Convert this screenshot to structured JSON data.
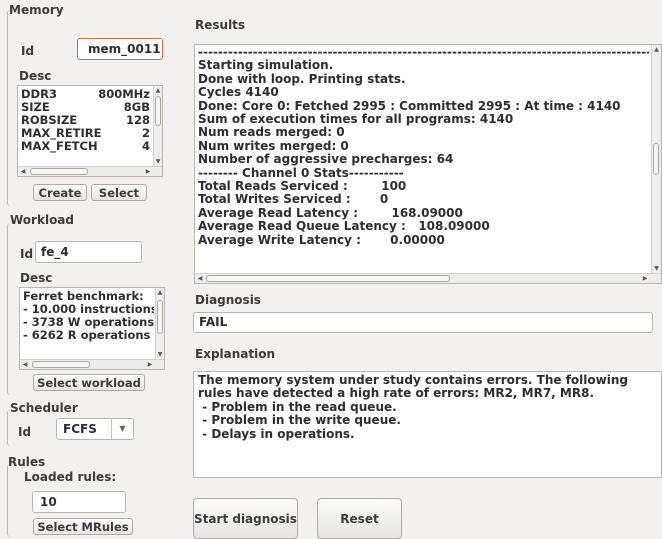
{
  "memory": {
    "title": "Memory",
    "id_label": "Id",
    "id_value": "mem_0011",
    "desc_label": "Desc",
    "desc_rows": [
      {
        "key": "DDR3",
        "value": "800MHz"
      },
      {
        "key": "SIZE",
        "value": "8GB"
      },
      {
        "key": "ROBSIZE",
        "value": "128"
      },
      {
        "key": "MAX_RETIRE",
        "value": "2"
      },
      {
        "key": "MAX_FETCH",
        "value": "4"
      }
    ],
    "create_label": "Create",
    "select_label": "Select"
  },
  "workload": {
    "title": "Workload",
    "id_label": "Id",
    "id_value": "fe_4",
    "desc_label": "Desc",
    "desc_rows": [
      "Ferret benchmark:",
      "- 10.000 instructions",
      "- 3738 W operations",
      "- 6262 R operations"
    ],
    "select_label": "Select workload"
  },
  "scheduler": {
    "title": "Scheduler",
    "id_label": "Id",
    "selected": "FCFS"
  },
  "rules": {
    "title": "Rules",
    "loaded_label": "Loaded rules:",
    "loaded_value": "10",
    "select_label": "Select MRules"
  },
  "results": {
    "title": "Results",
    "text": "-------------------------------------------------------------------------------------------------------\nStarting simulation.\nDone with loop. Printing stats.\nCycles 4140\nDone: Core 0: Fetched 2995 : Committed 2995 : At time : 4140\nSum of execution times for all programs: 4140\nNum reads merged: 0\nNum writes merged: 0\nNumber of aggressive precharges: 64\n-------- Channel 0 Stats-----------\nTotal Reads Serviced :        100\nTotal Writes Serviced :       0\nAverage Read Latency :        168.09000\nAverage Read Queue Latency :   108.09000\nAverage Write Latency :       0.00000"
  },
  "diagnosis": {
    "title": "Diagnosis",
    "value": "FAIL"
  },
  "explanation": {
    "title": "Explanation",
    "text": "The memory system under study contains errors. The following\nrules have detected a high rate of errors: MR2, MR7, MR8.\n - Problem in the read queue.\n - Problem in the write queue.\n - Delays in operations."
  },
  "actions": {
    "start_label": "Start diagnosis",
    "reset_label": "Reset"
  },
  "icons": {
    "arrow_up": "up-arrow-icon",
    "arrow_down": "down-arrow-icon",
    "arrow_left": "left-arrow-icon",
    "arrow_right": "right-arrow-icon",
    "dropdown": "chevron-down-icon"
  },
  "colors": {
    "background": "#f2f1f0",
    "focus_border": "#d86a41"
  }
}
